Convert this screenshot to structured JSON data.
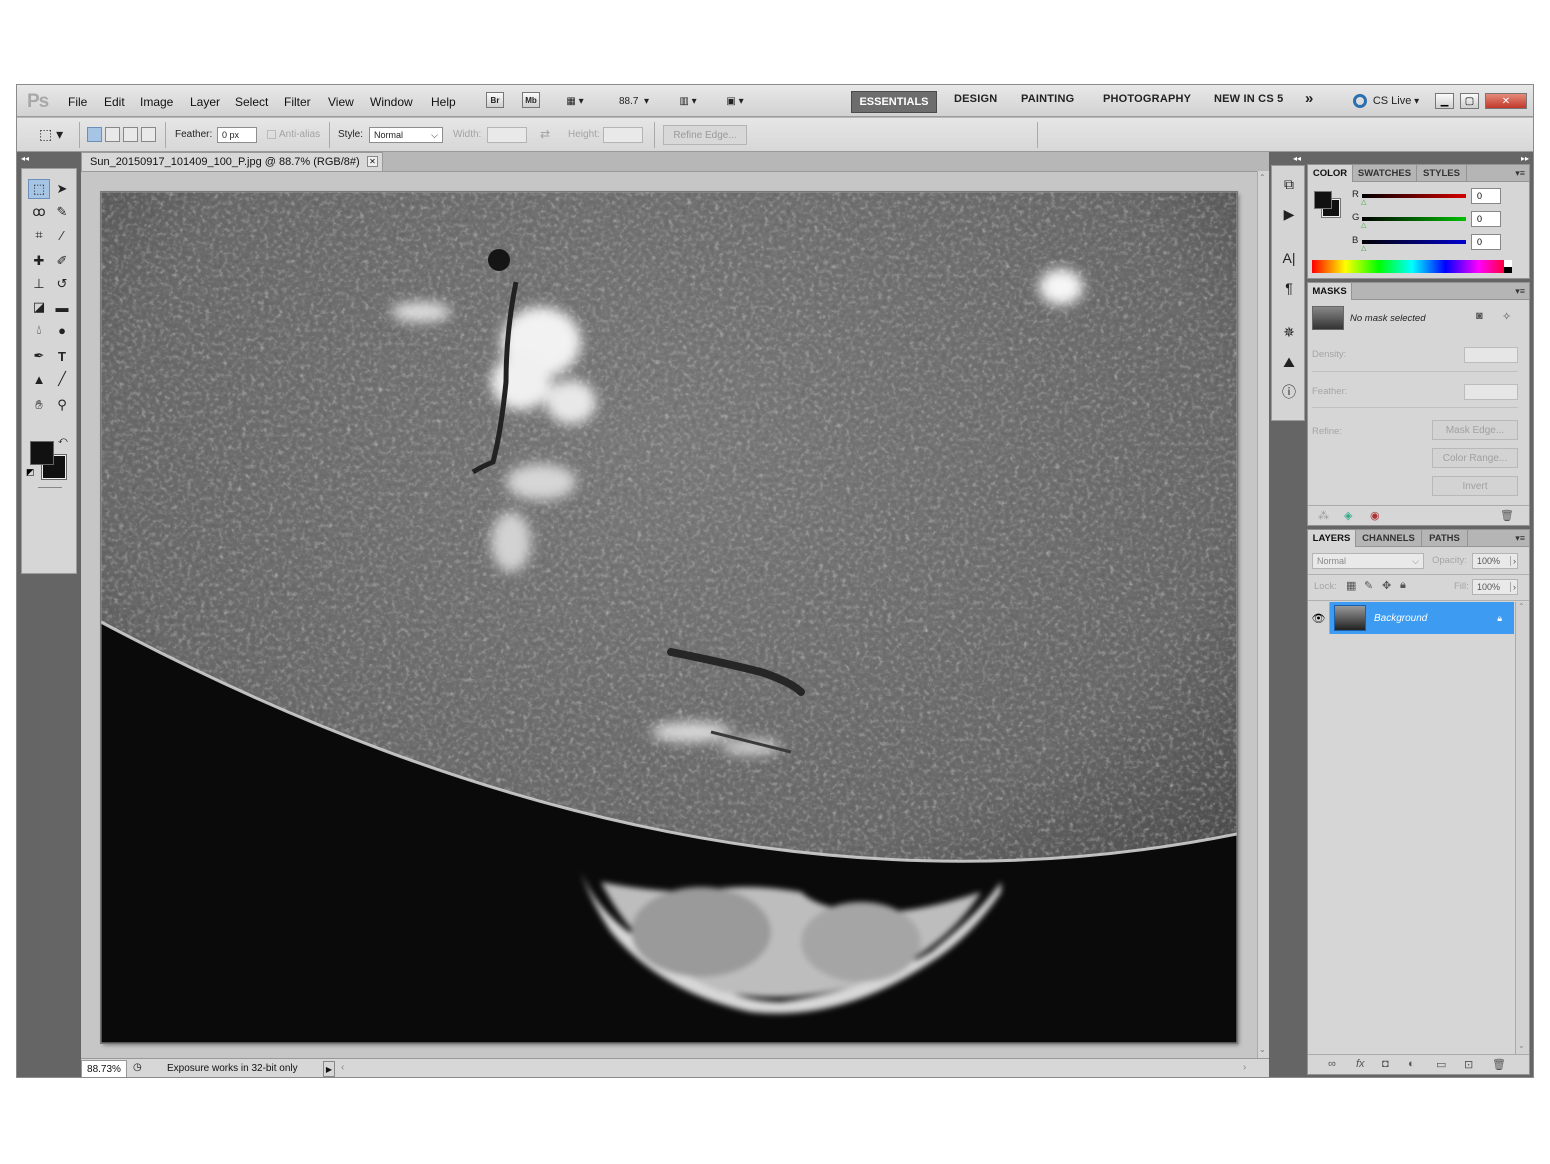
{
  "app": {
    "logo": "Ps"
  },
  "menu": {
    "items": [
      "File",
      "Edit",
      "Image",
      "Layer",
      "Select",
      "Filter",
      "View",
      "Window",
      "Help"
    ]
  },
  "appbar": {
    "bridge": "Br",
    "minibridge": "Mb",
    "zoom": "88.7"
  },
  "workspaces": {
    "active": "ESSENTIALS",
    "items": [
      "DESIGN",
      "PAINTING",
      "PHOTOGRAPHY",
      "NEW IN CS 5"
    ],
    "more": "»",
    "cslive": "CS Live"
  },
  "options": {
    "feather_label": "Feather:",
    "feather_value": "0 px",
    "antialias_label": "Anti-alias",
    "style_label": "Style:",
    "style_value": "Normal",
    "width_label": "Width:",
    "height_label": "Height:",
    "refine_edge": "Refine Edge..."
  },
  "document": {
    "tab_title": "Sun_20150917_101409_100_P.jpg @ 88.7% (RGB/8#)"
  },
  "status": {
    "zoom": "88.73%",
    "message": "Exposure works in 32-bit only"
  },
  "color_panel": {
    "tabs": [
      "COLOR",
      "SWATCHES",
      "STYLES"
    ],
    "channels": [
      {
        "label": "R",
        "value": "0",
        "color": "#d40000"
      },
      {
        "label": "G",
        "value": "0",
        "color": "#00c000"
      },
      {
        "label": "B",
        "value": "0",
        "color": "#0000d0"
      }
    ]
  },
  "masks_panel": {
    "tab": "MASKS",
    "status": "No mask selected",
    "density_label": "Density:",
    "feather_label": "Feather:",
    "refine_label": "Refine:",
    "mask_edge": "Mask Edge...",
    "color_range": "Color Range...",
    "invert": "Invert"
  },
  "layers_panel": {
    "tabs": [
      "LAYERS",
      "CHANNELS",
      "PATHS"
    ],
    "blend_mode": "Normal",
    "opacity_label": "Opacity:",
    "opacity_value": "100%",
    "lock_label": "Lock:",
    "fill_label": "Fill:",
    "fill_value": "100%",
    "layers": [
      {
        "name": "Background",
        "selected": true,
        "locked": true
      }
    ]
  },
  "colors": {
    "accent_selected": "#3d9bf2",
    "workspace_active": "#6d6d6d"
  }
}
